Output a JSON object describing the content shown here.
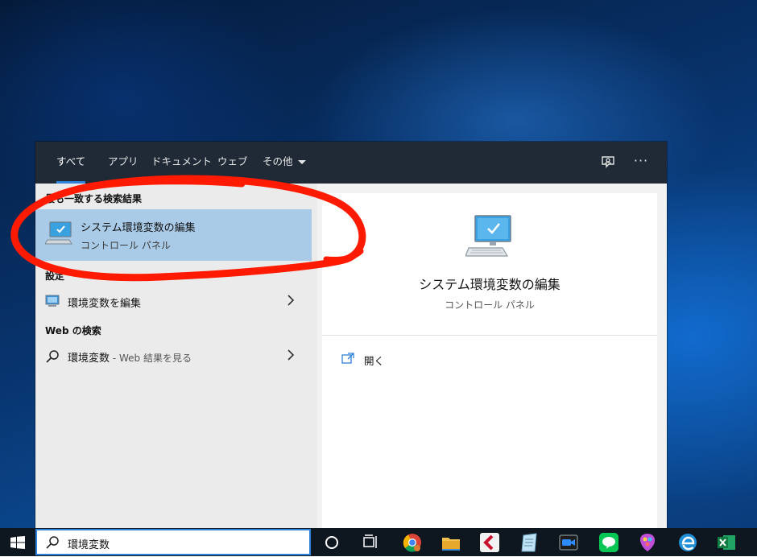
{
  "tabs": [
    {
      "label": "すべて"
    },
    {
      "label": "アプリ"
    },
    {
      "label": "ドキュメント"
    },
    {
      "label": "ウェブ"
    },
    {
      "label": "その他"
    }
  ],
  "best_match": {
    "heading": "最も一致する検索結果",
    "title": "システム環境変数の編集",
    "subtitle": "コントロール パネル"
  },
  "settings_section": {
    "heading": "設定",
    "item": "環境変数を編集"
  },
  "web_section": {
    "heading": "Web の検索",
    "query": "環境変数",
    "hint": " - Web 結果を見る"
  },
  "detail": {
    "title": "システム環境変数の編集",
    "subtitle": "コントロール パネル",
    "open_label": "開く"
  },
  "taskbar": {
    "search_value": "環境変数",
    "apps": [
      "chrome-icon",
      "file-explorer-icon",
      "app-icon",
      "notepad-icon",
      "zoom-icon",
      "line-icon",
      "paint-icon",
      "edge-icon",
      "excel-icon"
    ]
  },
  "colors": {
    "accent": "#2e80d8",
    "selection": "#a9cbe8",
    "annotation": "#ff1a00"
  }
}
